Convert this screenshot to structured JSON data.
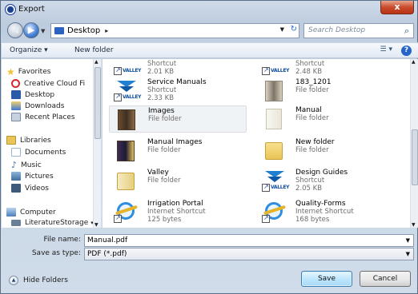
{
  "window": {
    "title": "Export",
    "close_label": "x"
  },
  "address": {
    "location": "Desktop",
    "chevron": "▸",
    "search_placeholder": "Search Desktop"
  },
  "toolbar": {
    "organize": "Organize ▾",
    "new_folder": "New folder"
  },
  "nav_pane": {
    "items": [
      {
        "label": "Favorites",
        "icon": "star-icon",
        "color": "#f1c232"
      },
      {
        "label": "Creative Cloud Fi",
        "icon": "creative-cloud-icon",
        "color": "#d7292b"
      },
      {
        "label": "Desktop",
        "icon": "desktop-icon",
        "color": "#2a5aa8"
      },
      {
        "label": "Downloads",
        "icon": "downloads-icon",
        "color": "#3c79d6"
      },
      {
        "label": "Recent Places",
        "icon": "recent-places-icon",
        "color": "#7a8aa0"
      },
      {
        "label": "Libraries",
        "icon": "libraries-icon",
        "color": "#e8c65a"
      },
      {
        "label": "Documents",
        "icon": "documents-icon",
        "color": "#9fb6d3"
      },
      {
        "label": "Music",
        "icon": "music-icon",
        "color": "#4b6ea8"
      },
      {
        "label": "Pictures",
        "icon": "pictures-icon",
        "color": "#3d6e9e"
      },
      {
        "label": "Videos",
        "icon": "videos-icon",
        "color": "#3e5a7a"
      },
      {
        "label": "Computer",
        "icon": "computer-icon",
        "color": "#4a7fc0"
      },
      {
        "label": "LiteratureStorage",
        "icon": "network-drive-icon",
        "color": "#6a7f96"
      }
    ]
  },
  "files": [
    {
      "name": "",
      "type": "Shortcut",
      "size": "2.01 KB",
      "icon": "shortcut-logo-icon"
    },
    {
      "name": "",
      "type": "Shortcut",
      "size": "2.48 KB",
      "icon": "shortcut-logo-icon"
    },
    {
      "name": "Service Manuals",
      "type": "Shortcut",
      "size": "2.33 KB",
      "icon": "shortcut-logo-icon"
    },
    {
      "name": "183_1201",
      "type": "File folder",
      "size": "",
      "icon": "folder-icon"
    },
    {
      "name": "Images",
      "type": "File folder",
      "size": "",
      "icon": "folder-icon"
    },
    {
      "name": "Manual",
      "type": "File folder",
      "size": "",
      "icon": "folder-icon"
    },
    {
      "name": "Manual Images",
      "type": "File folder",
      "size": "",
      "icon": "folder-icon"
    },
    {
      "name": "New folder",
      "type": "File folder",
      "size": "",
      "icon": "folder-icon"
    },
    {
      "name": "Valley",
      "type": "File folder",
      "size": "",
      "icon": "folder-icon"
    },
    {
      "name": "Design Guides",
      "type": "Shortcut",
      "size": "2.05 KB",
      "icon": "shortcut-logo-icon"
    },
    {
      "name": "Irrigation Portal",
      "type": "Internet Shortcut",
      "size": "125 bytes",
      "icon": "internet-shortcut-icon"
    },
    {
      "name": "Quality-Forms",
      "type": "Internet Shortcut",
      "size": "168 bytes",
      "icon": "internet-shortcut-icon"
    }
  ],
  "form": {
    "file_name_label": "File name:",
    "file_name_value": "Manual.pdf",
    "save_type_label": "Save as type:",
    "save_type_value": "PDF (*.pdf)"
  },
  "footer": {
    "hide_folders": "Hide Folders",
    "save": "Save",
    "cancel": "Cancel"
  },
  "logo_text": "VALLEY"
}
